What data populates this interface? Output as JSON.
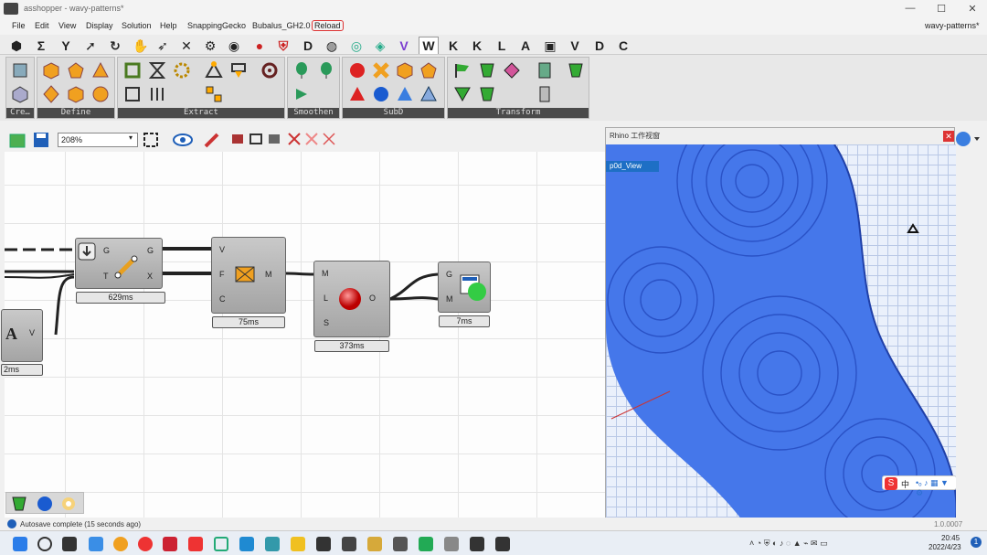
{
  "window": {
    "title": "asshopper - wavy-patterns*",
    "right_title": "wavy-patterns*"
  },
  "menu": [
    "File",
    "Edit",
    "View",
    "Display",
    "Solution",
    "Help",
    "SnappingGecko",
    "Bubalus_GH2.0",
    "Reload"
  ],
  "tabs": [
    "⬢",
    "Σ",
    "Y",
    "➚",
    "↻",
    "✋",
    "➶",
    "✕",
    "⚙",
    "◉",
    "●",
    "⛨",
    "D",
    "◍",
    "◎",
    "◈",
    "V",
    "W",
    "K",
    "K",
    "L",
    "A",
    "▣",
    "V",
    "D",
    "C"
  ],
  "ribbon_panels": [
    "Cre…",
    "Define",
    "Extract",
    "Smoothen",
    "SubD",
    "Transform"
  ],
  "zoom": "208%",
  "components": {
    "gate_time": "629ms",
    "map_time": "75ms",
    "render_time": "373ms",
    "preview_time": "7ms",
    "left_time": "2ms"
  },
  "ports": {
    "gate_in": [
      "G",
      "T"
    ],
    "gate_out": [
      "G",
      "X"
    ],
    "map_in": [
      "V",
      "F",
      "C"
    ],
    "map_out": "M",
    "mesh_in": [
      "M",
      "L",
      "S"
    ],
    "mesh_out": "O",
    "prev_in": [
      "G",
      "M"
    ],
    "left_in": "V",
    "left_glyph": "A"
  },
  "rhino": {
    "title": "Rhino 工作视窗",
    "view_tab": "p0d_View"
  },
  "status": {
    "text": "Autosave complete (15 seconds ago)",
    "version": "1.0.0007"
  },
  "clock": {
    "time": "20:45",
    "date": "2022/4/23"
  },
  "ime": "中"
}
